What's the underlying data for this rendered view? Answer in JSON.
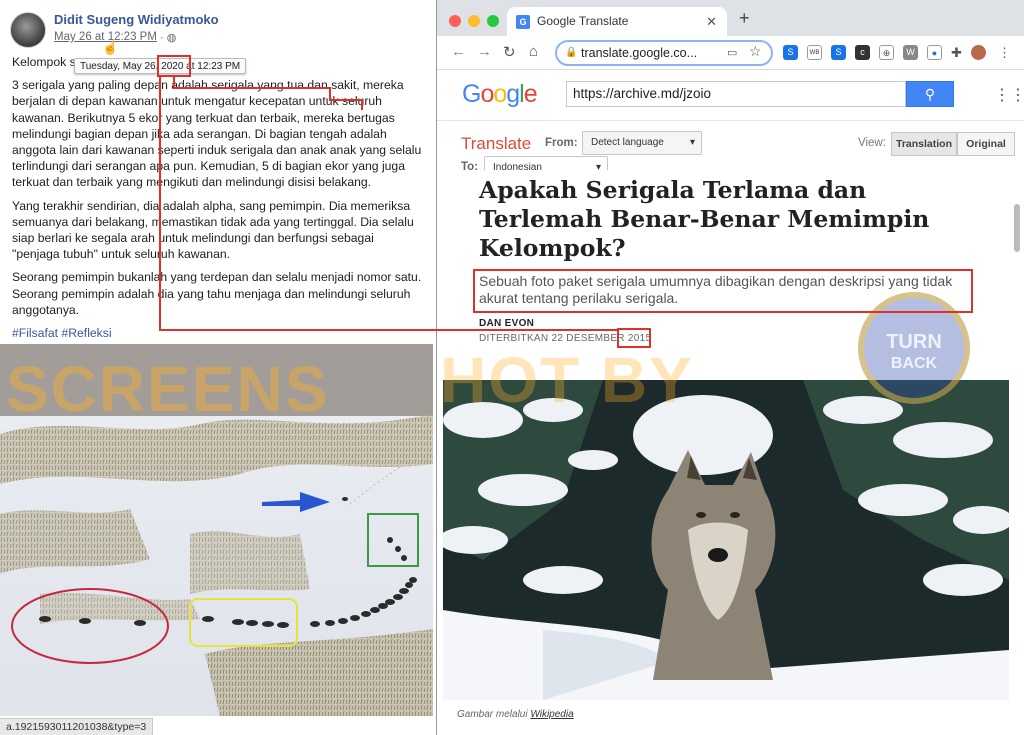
{
  "facebook": {
    "author": "Didit Sugeng Widiyatmoko",
    "date_link": "May 26 at 12:23 PM",
    "date_sep": "·",
    "tooltip": "Tuesday, May 26, 2020 at 12:23 PM",
    "paragraphs": [
      "Kelompok s",
      "3 serigala yang paling depan adalah serigala yang tua dan sakit, mereka berjalan di depan kawanan untuk mengatur kecepatan untuk seluruh kawanan. Berikutnya 5 ekor yang terkuat dan terbaik, mereka bertugas melindungi bagian depan jika ada serangan. Di bagian tengah adalah anggota lain dari kawanan seperti induk serigala dan anak anak yang selalu terlindungi dari serangan apa pun. Kemudian, 5 di bagian ekor yang juga terkuat dan terbaik yang mengikuti dan melindungi disisi belakang.",
      "Yang terakhir sendirian, dia adalah alpha, sang pemimpin. Dia memeriksa semuanya dari belakang, memastikan tidak ada yang tertinggal. Dia selalu siap berlari ke segala arah untuk melindungi dan berfungsi sebagai \"penjaga tubuh\" untuk seluruh kawanan.",
      "Seorang pemimpin bukanlah yang terdepan dan selalu menjadi nomor satu. Seorang pemimpin adalah dia yang tahu menjaga dan melindungi seluruh anggotanya."
    ],
    "hashtags": "#Filsafat #Refleksi",
    "status_url": "a.1921593011201038&type=3"
  },
  "browser": {
    "tab_title": "Google Translate",
    "tab_close": "✕",
    "new_tab": "+",
    "url": "translate.google.co..."
  },
  "google": {
    "search_value": "https://archive.md/jzoio",
    "translate_title": "Translate",
    "from_label": "From:",
    "from_value": "Detect language",
    "to_label": "To:",
    "to_value": "Indonesian",
    "view_label": "View:",
    "view_translation": "Translation",
    "view_original": "Original"
  },
  "article": {
    "title": "Apakah Serigala Terlama dan Terlemah Benar-Benar Memimpin Kelompok?",
    "subtitle": "Sebuah foto paket serigala umumnya dibagikan dengan deskripsi yang tidak akurat tentang perilaku serigala.",
    "author": "DAN EVON",
    "published_prefix": "DITERBITKAN 22 DESEMBER",
    "published_year": "2015",
    "caption_prefix": "Gambar melalui",
    "caption_link": "Wikipedia"
  },
  "watermark": {
    "text_left": "SCREENS",
    "text_right": "HOT BY",
    "badge_line1": "TURN",
    "badge_line2": "BACK"
  },
  "colors": {
    "annotation_red": "#e0302a",
    "ellipse_red": "#c8283c",
    "box_yellow": "#e8e23a",
    "box_green": "#3a9a4a",
    "arrow_blue": "#2a55d0",
    "google_blue": "#4285f4",
    "translate_red": "#dd4b39"
  }
}
